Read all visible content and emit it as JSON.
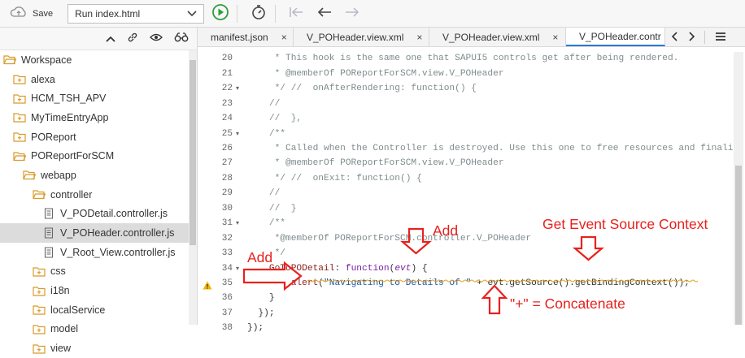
{
  "toolbar": {
    "save_label": "Save",
    "run_config": "Run index.html"
  },
  "sidebar": {
    "items": [
      {
        "label": "Workspace",
        "level": 0,
        "type": "folder-open"
      },
      {
        "label": "alexa",
        "level": 1,
        "type": "folder-plus"
      },
      {
        "label": "HCM_TSH_APV",
        "level": 1,
        "type": "folder-plus"
      },
      {
        "label": "MyTimeEntryApp",
        "level": 1,
        "type": "folder-plus"
      },
      {
        "label": "POReport",
        "level": 1,
        "type": "folder-plus"
      },
      {
        "label": "POReportForSCM",
        "level": 1,
        "type": "folder-open"
      },
      {
        "label": "webapp",
        "level": 2,
        "type": "folder-open"
      },
      {
        "label": "controller",
        "level": 3,
        "type": "folder-open"
      },
      {
        "label": "V_PODetail.controller.js",
        "level": 4,
        "type": "file"
      },
      {
        "label": "V_POHeader.controller.js",
        "level": 4,
        "type": "file",
        "selected": true
      },
      {
        "label": "V_Root_View.controller.js",
        "level": 4,
        "type": "file"
      },
      {
        "label": "css",
        "level": 3,
        "type": "folder-plus"
      },
      {
        "label": "i18n",
        "level": 3,
        "type": "folder-plus"
      },
      {
        "label": "localService",
        "level": 3,
        "type": "folder-plus"
      },
      {
        "label": "model",
        "level": 3,
        "type": "folder-plus"
      },
      {
        "label": "view",
        "level": 3,
        "type": "folder-plus"
      }
    ]
  },
  "tabs": [
    {
      "label": "manifest.json",
      "close": "×"
    },
    {
      "label": "V_POHeader.view.xml",
      "close": "×"
    },
    {
      "label": "V_POHeader.view.xml",
      "close": "×"
    },
    {
      "label": "V_POHeader.contr",
      "close": "",
      "active": true
    }
  ],
  "code": {
    "lines": [
      {
        "n": "20",
        "text": "     * This hook is the same one that SAPUI5 controls get after being rendered."
      },
      {
        "n": "21",
        "text": "     * @memberOf POReportForSCM.view.V_POHeader"
      },
      {
        "n": "22",
        "text": "     */ //  onAfterRendering: function() {",
        "fold": true
      },
      {
        "n": "23",
        "text": "    //"
      },
      {
        "n": "24",
        "text": "    //  },"
      },
      {
        "n": "25",
        "text": "    /**",
        "fold": true
      },
      {
        "n": "26",
        "text": "     * Called when the Controller is destroyed. Use this one to free resources and finali"
      },
      {
        "n": "27",
        "text": "     * @memberOf POReportForSCM.view.V_POHeader"
      },
      {
        "n": "28",
        "text": "     */ //  onExit: function() {"
      },
      {
        "n": "29",
        "text": "    //"
      },
      {
        "n": "30",
        "text": "    //  }"
      },
      {
        "n": "31",
        "text": "    /**",
        "fold": true
      },
      {
        "n": "32",
        "text": "     *@memberOf POReportForSCM.controller.V_POHeader"
      },
      {
        "n": "33",
        "text": "     */"
      },
      {
        "n": "34",
        "text": "    GoToPODetail: function(evt) {",
        "fold": true
      },
      {
        "n": "35",
        "text": "        alert(\"Navigating to Details of \" + evt.getSource().getBindingContext());",
        "warn": true
      },
      {
        "n": "36",
        "text": "    }"
      },
      {
        "n": "37",
        "text": "  });"
      },
      {
        "n": "38",
        "text": "});"
      }
    ]
  },
  "annotations": {
    "add_top": "Add",
    "add_left": "Add",
    "event_source": "Get Event Source Context",
    "concat": "\"+\" = Concatenate"
  },
  "colors": {
    "annotation": "#e8211d",
    "accent": "#2b7bd3",
    "run": "#2e9e3a"
  }
}
